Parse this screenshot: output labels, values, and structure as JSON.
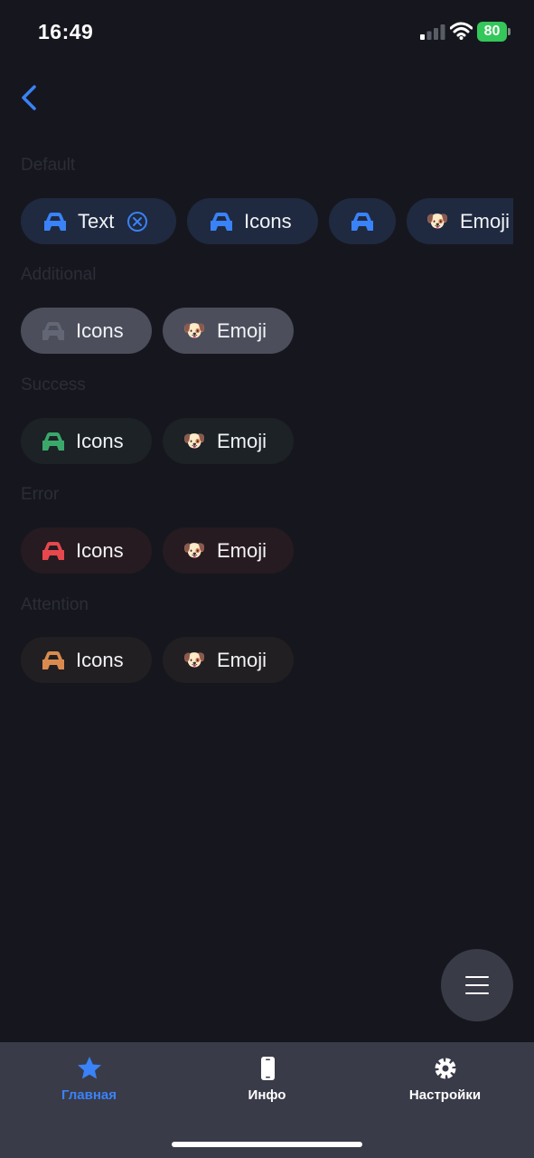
{
  "status": {
    "time": "16:49",
    "battery": "80"
  },
  "colors": {
    "accent": "#3a82f7",
    "success": "#3aa86b",
    "error": "#e5484d",
    "attention": "#d98b4f",
    "inactive": "#636674"
  },
  "sections": {
    "default": {
      "label": "Default",
      "chips": {
        "text": "Text",
        "icons": "Icons",
        "emoji": "Emoji",
        "emoji_glyph": "🐶"
      }
    },
    "additional": {
      "label": "Additional",
      "icons": "Icons",
      "emoji": "Emoji",
      "emoji_glyph": "🐶"
    },
    "success": {
      "label": "Success",
      "icons": "Icons",
      "emoji": "Emoji",
      "emoji_glyph": "🐶"
    },
    "error": {
      "label": "Error",
      "icons": "Icons",
      "emoji": "Emoji",
      "emoji_glyph": "🐶"
    },
    "attention": {
      "label": "Attention",
      "icons": "Icons",
      "emoji": "Emoji",
      "emoji_glyph": "🐶"
    }
  },
  "tabs": [
    {
      "label": "Главная",
      "icon": "star-icon",
      "active": true
    },
    {
      "label": "Инфо",
      "icon": "phone-icon",
      "active": false
    },
    {
      "label": "Настройки",
      "icon": "gear-icon",
      "active": false
    }
  ]
}
